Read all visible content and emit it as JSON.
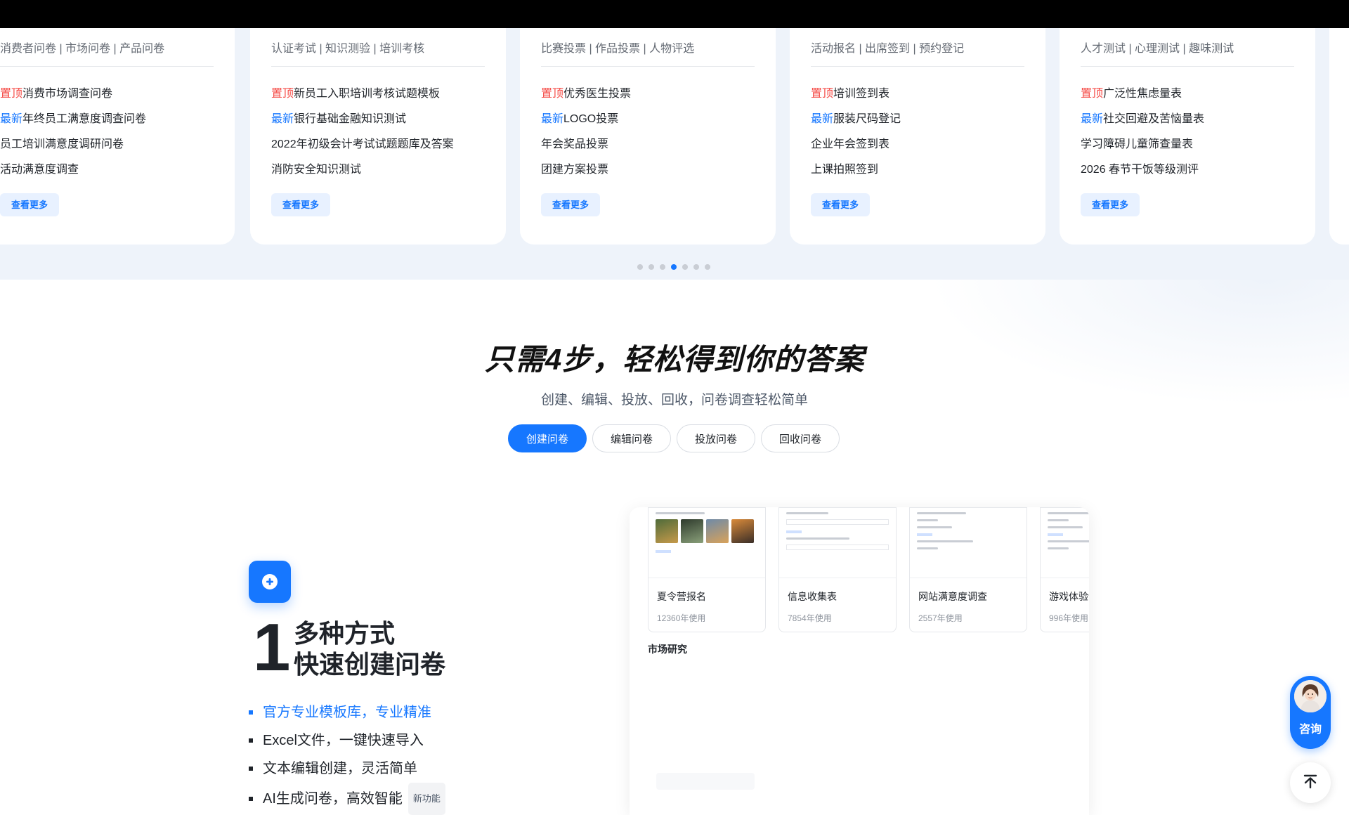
{
  "carousel": {
    "cards": [
      {
        "tags": "消费者问卷 | 市场问卷 | 产品问卷",
        "items": [
          {
            "tag": "置顶",
            "kind": "top",
            "text": "消费市场调查问卷"
          },
          {
            "tag": "最新",
            "kind": "new",
            "text": "年终员工满意度调查问卷"
          },
          {
            "tag": "",
            "kind": "",
            "text": "员工培训满意度调研问卷"
          },
          {
            "tag": "",
            "kind": "",
            "text": "活动满意度调查"
          }
        ],
        "more": "查看更多"
      },
      {
        "tags": "认证考试 | 知识测验 | 培训考核",
        "items": [
          {
            "tag": "置顶",
            "kind": "top",
            "text": "新员工入职培训考核试题模板"
          },
          {
            "tag": "最新",
            "kind": "new",
            "text": "银行基础金融知识测试"
          },
          {
            "tag": "",
            "kind": "",
            "text": "2022年初级会计考试试题题库及答案"
          },
          {
            "tag": "",
            "kind": "",
            "text": "消防安全知识测试"
          }
        ],
        "more": "查看更多"
      },
      {
        "tags": "比赛投票 | 作品投票 | 人物评选",
        "items": [
          {
            "tag": "置顶",
            "kind": "top",
            "text": "优秀医生投票"
          },
          {
            "tag": "最新",
            "kind": "new",
            "text": "LOGO投票"
          },
          {
            "tag": "",
            "kind": "",
            "text": "年会奖品投票"
          },
          {
            "tag": "",
            "kind": "",
            "text": "团建方案投票"
          }
        ],
        "more": "查看更多"
      },
      {
        "tags": "活动报名 |  出席签到 | 预约登记",
        "items": [
          {
            "tag": "置顶",
            "kind": "top",
            "text": "培训签到表"
          },
          {
            "tag": "最新",
            "kind": "new",
            "text": "服装尺码登记"
          },
          {
            "tag": "",
            "kind": "",
            "text": "企业年会签到表"
          },
          {
            "tag": "",
            "kind": "",
            "text": "上课拍照签到"
          }
        ],
        "more": "查看更多"
      },
      {
        "tags": "人才测试 |  心理测试 | 趣味测试",
        "items": [
          {
            "tag": "置顶",
            "kind": "top",
            "text": "广泛性焦虑量表"
          },
          {
            "tag": "最新",
            "kind": "new",
            "text": "社交回避及苦恼量表"
          },
          {
            "tag": "",
            "kind": "",
            "text": "学习障碍儿童筛查量表"
          },
          {
            "tag": "",
            "kind": "",
            "text": "2026 春节干饭等级测评"
          }
        ],
        "more": "查看更多"
      }
    ],
    "page_count": 7,
    "active_page": 4
  },
  "steps": {
    "title": "只需4步，轻松得到你的答案",
    "subtitle": "创建、编辑、投放、回收，问卷调查轻松简单",
    "tabs": [
      "创建问卷",
      "编辑问卷",
      "投放问卷",
      "回收问卷"
    ],
    "active_tab": 0
  },
  "step1": {
    "number": "1",
    "heading_line1": "多种方式",
    "heading_line2": "快速创建问卷",
    "features": [
      "官方专业模板库，专业精准",
      "Excel文件，一键快速导入",
      "文本编辑创建，灵活简单",
      "AI生成问卷，高效智能"
    ],
    "new_badge": "新功能",
    "icon": "plus-circle-icon"
  },
  "preview": {
    "templates": [
      {
        "name": "夏令营报名",
        "uses": "12360年使用"
      },
      {
        "name": "信息收集表",
        "uses": "7854年使用"
      },
      {
        "name": "网站满意度调查",
        "uses": "2557年使用"
      },
      {
        "name": "游戏体验调",
        "uses": "996年使用"
      }
    ],
    "section_label": "市场研究"
  },
  "float": {
    "consult_label": "咨询",
    "backtop_icon": "arrow-up-to-top-icon"
  },
  "colors": {
    "accent": "#1677ff",
    "top_tag": "#f54a45",
    "band": "#eef3fa"
  }
}
